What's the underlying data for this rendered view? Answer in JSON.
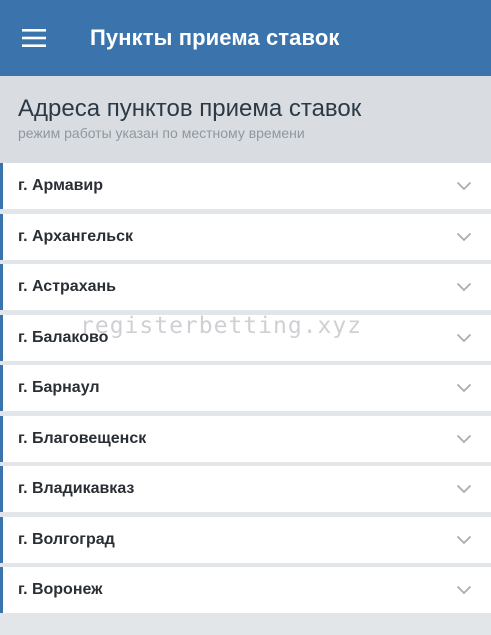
{
  "appbar": {
    "title": "Пункты приема ставок",
    "menu_icon": "hamburger-menu-icon"
  },
  "header": {
    "title": "Адреса пунктов приема ставок",
    "subtitle": "режим работы указан по местному времени"
  },
  "cities": [
    {
      "label": "г. Армавир"
    },
    {
      "label": "г. Архангельск"
    },
    {
      "label": "г. Астрахань"
    },
    {
      "label": "г. Балаково"
    },
    {
      "label": "г. Барнаул"
    },
    {
      "label": "г. Благовещенск"
    },
    {
      "label": "г. Владикавказ"
    },
    {
      "label": "г. Волгоград"
    },
    {
      "label": "г. Воронеж"
    }
  ],
  "row_icon": "chevron-down-icon",
  "watermark": "registerbetting.xyz",
  "colors": {
    "appbar": "#3b74ad",
    "accent_border": "#3b74ad",
    "header_bg": "#d9dde2",
    "row_bg": "#ffffff"
  }
}
